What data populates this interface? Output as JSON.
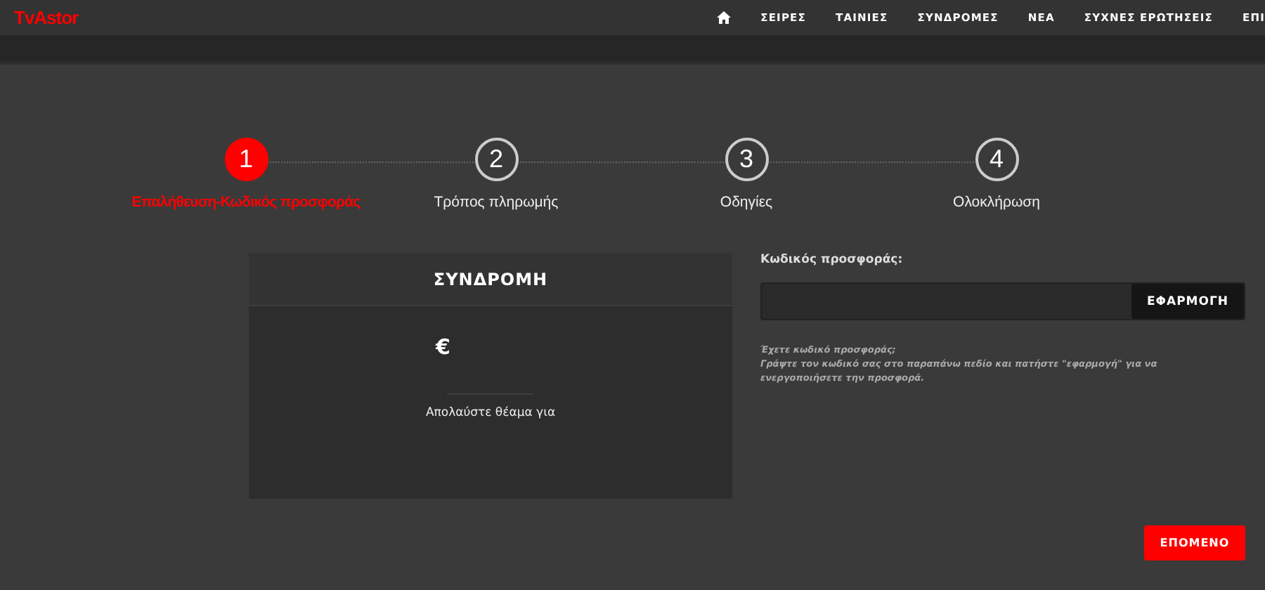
{
  "header": {
    "logo": "TvAstor",
    "nav": [
      {
        "label": "ΣΕΙΡΕΣ"
      },
      {
        "label": "ΤΑΙΝΙΕΣ"
      },
      {
        "label": "ΣΥΝΔΡΟΜΕΣ"
      },
      {
        "label": "ΝΕΑ"
      },
      {
        "label": "ΣΥΧΝΕΣ ΕΡΩΤΗΣΕΙΣ"
      },
      {
        "label": "ΕΠΙ"
      }
    ]
  },
  "steps": [
    {
      "number": "1",
      "label": "Επαλήθευση-Κωδικός προσφοράς",
      "selected": true
    },
    {
      "number": "2",
      "label": "Τρόπος πληρωμής",
      "selected": false
    },
    {
      "number": "3",
      "label": "Οδηγίες",
      "selected": false
    },
    {
      "number": "4",
      "label": "Ολοκλήρωση",
      "selected": false
    }
  ],
  "subscription": {
    "title": "ΣΥΝΔΡΟΜΗ",
    "price": "€",
    "description": "Απολαύστε θέαμα για"
  },
  "promo": {
    "label": "Κωδικός προσφοράς:",
    "apply_button": "ΕΦΑΡΜΟΓΗ",
    "question": "Έχετε κωδικό προσφοράς;",
    "instructions": "Γράψτε τον κωδικό σας στο παραπάνω πεδίο και πατήστε \"εφαρμογή\" για να ενεργοποιήσετε την προσφορά."
  },
  "next_button": "ΕΠΟΜΕΝΟ"
}
